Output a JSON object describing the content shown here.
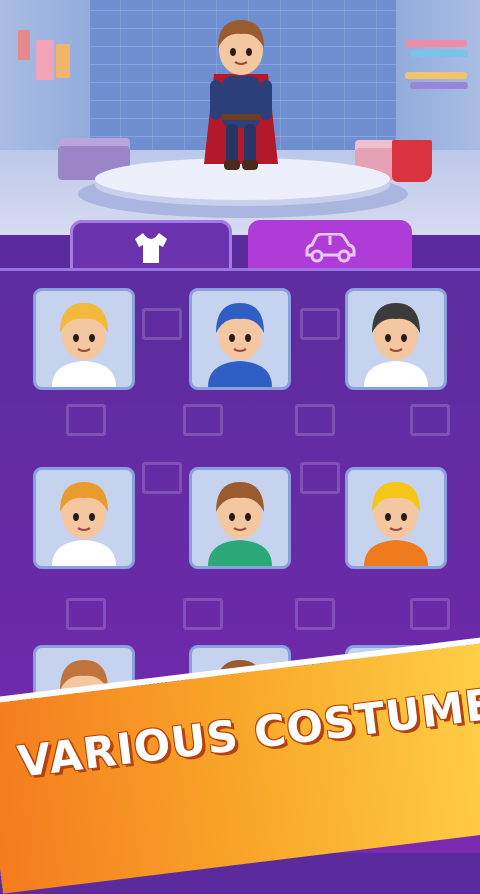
{
  "tabs": [
    {
      "name": "outfits",
      "icon": "tshirt-icon",
      "selected": true
    },
    {
      "name": "vehicles",
      "icon": "car-icon",
      "selected": false
    }
  ],
  "costumes": [
    {
      "icon": "blonde-boy-avatar-icon",
      "hair": "#f2b93a",
      "outfit": "#ffffff"
    },
    {
      "icon": "captain-hero-avatar-icon",
      "hair": "#2f5fc4",
      "outfit": "#2f5fc4"
    },
    {
      "icon": "helmet-soldier-avatar-icon",
      "hair": "#3b3b3b",
      "outfit": "#ffffff"
    },
    {
      "icon": "adventurer-avatar-icon",
      "hair": "#e99b2c",
      "outfit": "#ffffff"
    },
    {
      "icon": "tracksuit-avatar-icon",
      "hair": "#9a5b2e",
      "outfit": "#2aa878"
    },
    {
      "icon": "construction-worker-avatar-icon",
      "hair": "#f5c518",
      "outfit": "#f07a1e"
    },
    {
      "icon": "scarecrow-farmer-avatar-icon",
      "hair": "#c0733a",
      "outfit": "#c93a2f"
    },
    {
      "icon": "pajama-avatar-icon",
      "hair": "#9a5b2e",
      "outfit": "#3f73d6"
    },
    {
      "icon": "racer-helmet-avatar-icon",
      "hair": "#2a4fc2",
      "outfit": "#2a4fc2"
    }
  ],
  "banner": {
    "text": "VARIOUS COSTUMES"
  },
  "colors": {
    "panel": "#5c2d9e",
    "tab_active": "#6a33ad",
    "tab_inactive": "#b03cd8",
    "banner_start": "#f47b1e",
    "banner_end": "#ffd24a"
  }
}
